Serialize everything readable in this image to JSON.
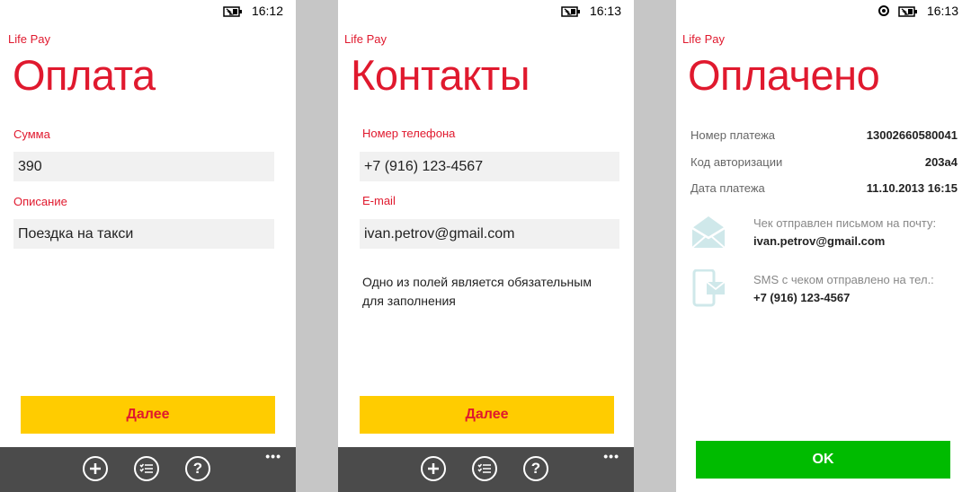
{
  "colors": {
    "accent": "#e0192e",
    "yellow": "#ffcc00",
    "green": "#00bb00",
    "appbar": "#4b4b4b",
    "icon_tint": "#cfe8ea"
  },
  "screen1": {
    "time": "16:12",
    "app_name": "Life Pay",
    "title": "Оплата",
    "amount_label": "Сумма",
    "amount_value": "390",
    "desc_label": "Описание",
    "desc_value": "Поездка на такси",
    "next_label": "Далее",
    "appbar_icons": [
      "add-icon",
      "list-icon",
      "help-icon"
    ],
    "more": "•••"
  },
  "screen2": {
    "time": "16:13",
    "app_name": "Life Pay",
    "title": "Контакты",
    "phone_label": "Номер телефона",
    "phone_value": "+7 (916) 123-4567",
    "email_label": "E-mail",
    "email_value": "ivan.petrov@gmail.com",
    "note": "Одно из полей является обязательным для заполнения",
    "next_label": "Далее",
    "appbar_icons": [
      "add-icon",
      "list-icon",
      "help-icon"
    ],
    "more": "•••"
  },
  "screen3": {
    "time": "16:13",
    "app_name": "Life Pay",
    "title": "Оплачено",
    "rows": [
      {
        "key": "Номер платежа",
        "value": "13002660580041"
      },
      {
        "key": "Код авторизации",
        "value": "203a4"
      },
      {
        "key": "Дата платежа",
        "value": "11.10.2013 16:15"
      }
    ],
    "email_note": "Чек отправлен письмом на почту:",
    "email_value": "ivan.petrov@gmail.com",
    "sms_note": "SMS с чеком отправлено на тел.:",
    "sms_value": "+7 (916) 123-4567",
    "ok_label": "OK"
  }
}
